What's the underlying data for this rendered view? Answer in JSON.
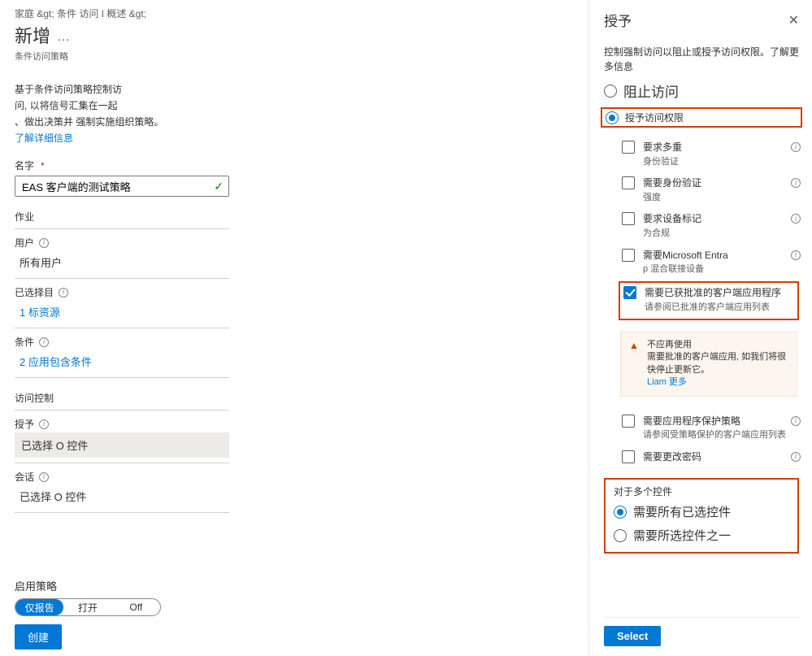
{
  "breadcrumb": "家庭 &gt;  条件 访问 I 概述 &gt;",
  "title": "新增",
  "more": "…",
  "subtitle": "条件访问策略",
  "desc1": "基于条件访问策略控制访",
  "desc2": "问, 以将信号汇集在一起",
  "desc3": "、做出决策并 强制实施组织策略。",
  "desc_link": "了解详细信息",
  "left": {
    "name_label": "名字",
    "name_value": "EAS 客户端的测试策略",
    "assign_label": "作业",
    "users_label": "用户",
    "users_value": "所有用户",
    "selected_label": "已选择目",
    "selected_value": "1 标资源",
    "conditions_label": "条件",
    "conditions_value": "2 应用包含条件",
    "access_label": "访问控制",
    "grant_label": "授予",
    "grant_value": "已选择 O 控件",
    "session_label": "会话",
    "session_value": "已选择 O 控件"
  },
  "footer": {
    "enable_label": "启用策略",
    "opt_report": "仅报告",
    "opt_on": "打开",
    "opt_off": "Off",
    "create": "创建"
  },
  "right": {
    "title": "授予",
    "desc": "控制强制访问以阻止或授予访问权限。了解更多信息",
    "block": "阻止访问",
    "grant": "授予访问权限",
    "checks": {
      "mfa": "要求多重",
      "mfa_sub": "身份验证",
      "strength": "需要身份验证",
      "strength_sub": "强度",
      "device": "要求设备标记",
      "device_sub": "为合规",
      "entra": "需要Microsoft Entra",
      "entra_sub": "p 混合联接设备",
      "approved": "需要已获批准的客户端应用程序",
      "approved_sub": "请参阅已批准的客户端应用列表",
      "warn": "不应再使用",
      "warn_sub": "需要批准的客户端应用, 如我们将很快停止更新它。",
      "warn_link": "Liam 更多",
      "protect": "需要应用程序保护策略",
      "protect_sub": "请参阅受策略保护的客户端应用列表",
      "pwd": "需要更改密码"
    },
    "multi": {
      "title": "对于多个控件",
      "all": "需要所有已选控件",
      "one": "需要所选控件之一"
    },
    "select": "Select"
  }
}
